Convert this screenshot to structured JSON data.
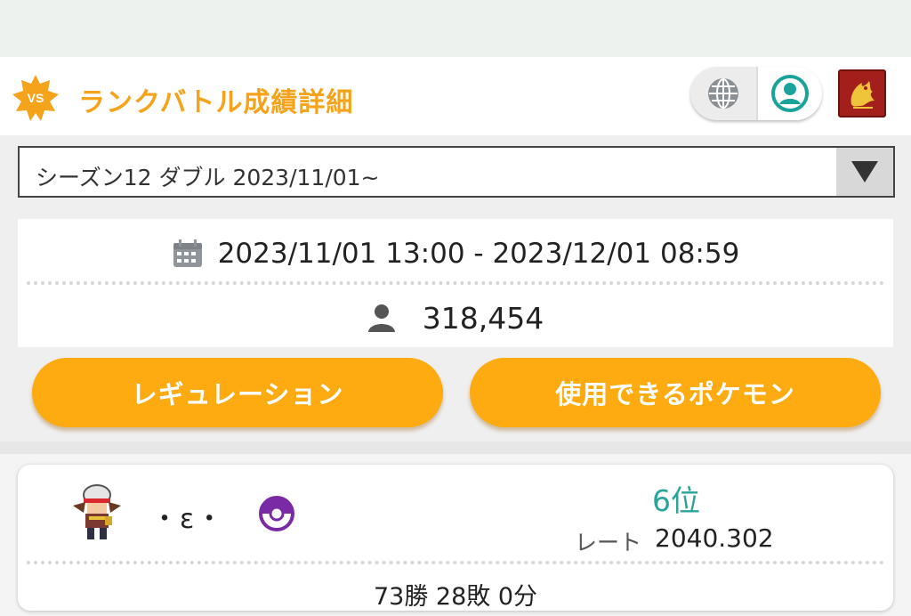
{
  "header": {
    "badge_text": "VS",
    "title": "ランクバトル成績詳細",
    "globe_icon": "globe-icon",
    "profile_icon": "user-circle-icon",
    "emblem_icon": "dragon-emblem-icon"
  },
  "season_select": {
    "selected": "シーズン12 ダブル 2023/11/01~"
  },
  "info": {
    "period": "2023/11/01 13:00 - 2023/12/01 08:59",
    "players": "318,454"
  },
  "buttons": {
    "regulation": "レギュレーション",
    "usable_pokemon": "使用できるポケモン"
  },
  "ranking_entry": {
    "player_name": "・ε・",
    "rank": "6位",
    "rate_label": "レート",
    "rate_value": "2040.302",
    "record": "73勝 28敗 0分"
  },
  "colors": {
    "accent": "#f4a31b",
    "button": "#fdab10",
    "rank": "#2aa49a",
    "ball": "#7b2aa5",
    "emblem": "#a21f1c"
  }
}
